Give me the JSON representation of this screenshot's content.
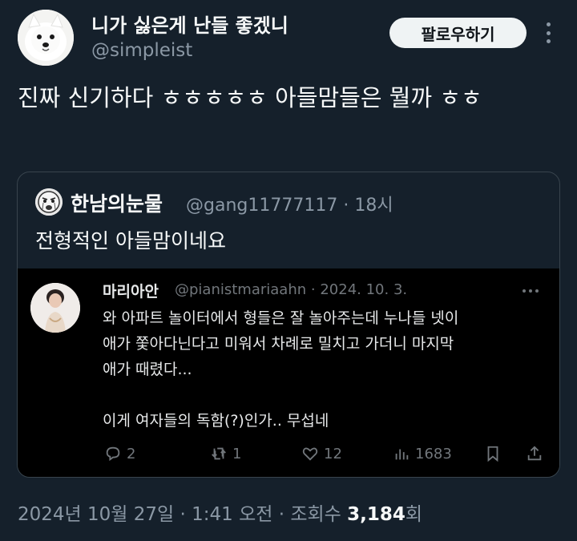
{
  "author": {
    "display_name": "니가 싫은게 난들 좋겠니",
    "handle": "@simpleist",
    "avatar": "samoyed-dog-avatar"
  },
  "follow_label": "팔로우하기",
  "post_text": "진짜 신기하다 ㅎㅎㅎㅎㅎ 아들맘들은 뭘까 ㅎㅎ",
  "quote": {
    "display_name": "한남의눈물",
    "handle": "@gang11777117",
    "time": "18시",
    "text": "전형적인 아들맘이네요",
    "avatar": "crying-face-avatar",
    "embedded": {
      "display_name": "마리아안",
      "handle": "@pianistmariaahn",
      "date": "2024. 10. 3.",
      "lines": [
        "와 아파트 놀이터에서 형들은 잘 놀아주는데 누나들 넷이",
        "애가 쫓아다닌다고 미워서 차례로 밀치고 가더니 마지막",
        "애가 때렸다...",
        "",
        "이게 여자들의 독함(?)인가.. 무섭네"
      ],
      "replies": "2",
      "reposts": "1",
      "likes": "12",
      "views": "1683"
    }
  },
  "footer": {
    "date": "2024년 10월 27일",
    "time": "1:41 오전",
    "views_label": "조회수",
    "views_count": "3,184",
    "views_suffix": "회"
  },
  "colors": {
    "background": "#15202b",
    "primary_text": "#f7f9f9",
    "secondary_text": "#8b98a5",
    "border": "#38444d"
  }
}
